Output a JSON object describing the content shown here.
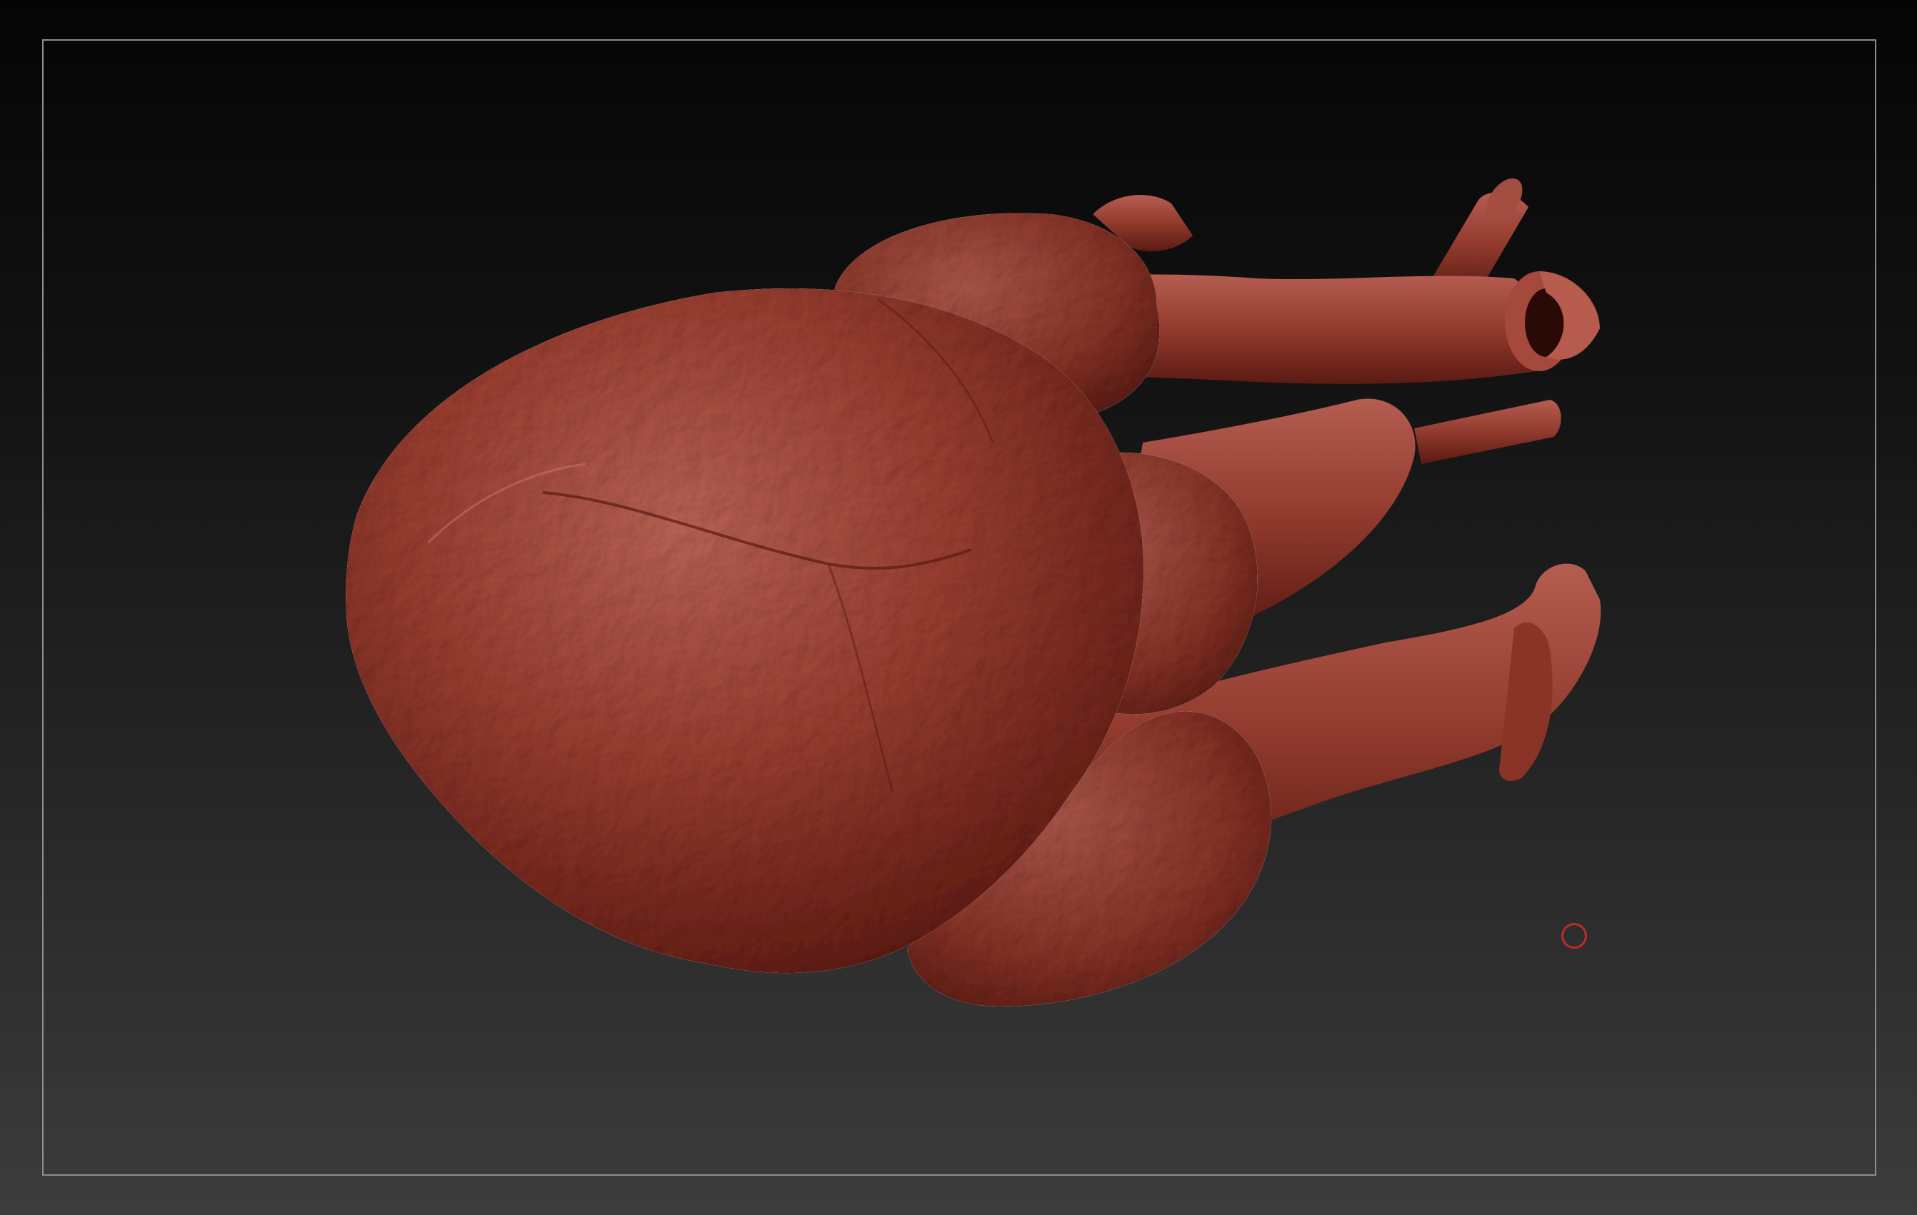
{
  "viewport": {
    "background_top": "#050505",
    "background_bottom": "#3c3c3c",
    "frame_color": "#8e8e8e"
  },
  "model": {
    "material_base": "#9a3b2f",
    "material_highlight": "#c0685a",
    "material_shadow": "#4a120c"
  },
  "cursor": {
    "icon": "brush-circle-icon",
    "color": "#c02a2a"
  }
}
